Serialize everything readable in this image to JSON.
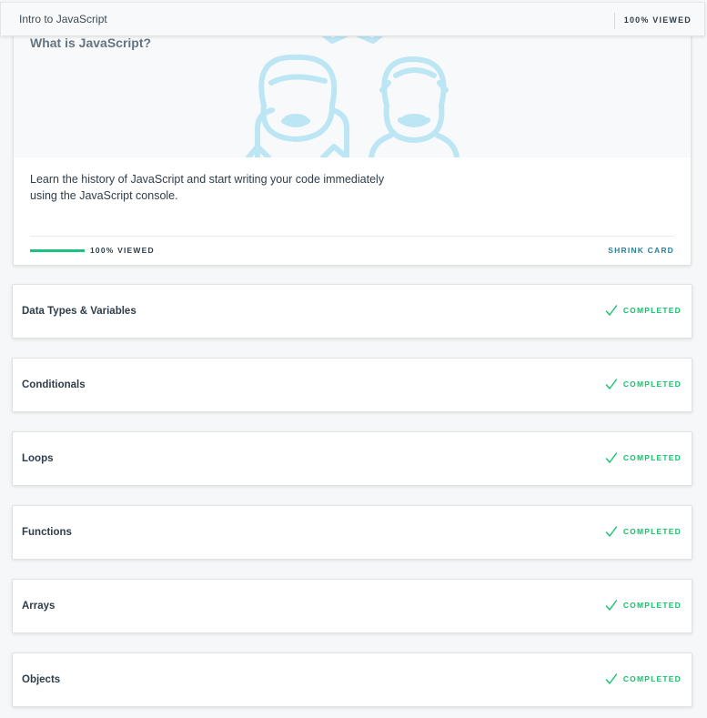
{
  "topbar": {
    "course_title": "Intro to JavaScript",
    "viewed_label": "100% VIEWED"
  },
  "hero": {
    "title": "What is JavaScript?",
    "description": "Learn the history of JavaScript and start writing your code immediately using the JavaScript console.",
    "progress_percent": 100,
    "progress_label": "100% VIEWED",
    "shrink_label": "SHRINK CARD",
    "illustration": "two-smiling-people-illustration"
  },
  "lessons": [
    {
      "title": "Data Types & Variables",
      "status": "COMPLETED"
    },
    {
      "title": "Conditionals",
      "status": "COMPLETED"
    },
    {
      "title": "Loops",
      "status": "COMPLETED"
    },
    {
      "title": "Functions",
      "status": "COMPLETED"
    },
    {
      "title": "Arrays",
      "status": "COMPLETED"
    },
    {
      "title": "Objects",
      "status": "COMPLETED"
    }
  ],
  "colors": {
    "progress_fill": "#1ec27f",
    "completed": "#15c26b",
    "shrink_link": "#2b7f97",
    "illustration": "#bde6f5"
  }
}
